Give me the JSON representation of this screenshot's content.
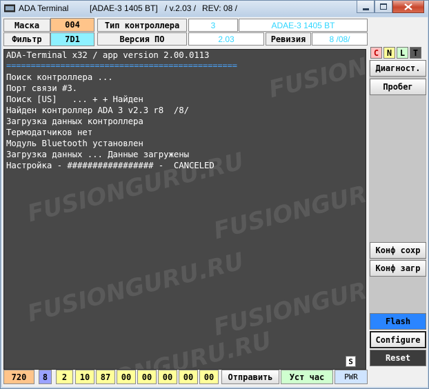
{
  "window": {
    "title": "ADA Terminal",
    "device": "[ADAE-3 1405 BT]",
    "version": "/ v.2.03 /",
    "rev": "REV: 08 /"
  },
  "header": {
    "mask_label": "Маска",
    "mask_value": "004",
    "filter_label": "Фильтр",
    "filter_value": "7D1",
    "controller_type_label": "Тип контроллера",
    "controller_type_num": "3",
    "controller_type_name": "ADAE-3 1405 BT",
    "sw_version_label": "Версия ПО",
    "sw_version_value": "2.03",
    "revision_label": "Ревизия",
    "revision_value": "8 /08/"
  },
  "terminal": {
    "lines": [
      "ADA-Terminal x32 / app version 2.00.0113",
      "===============================================",
      "Поиск контроллера ...",
      "Порт связи #3.",
      "Поиск [US]   ... + + Найден",
      "Найден контроллер ADA 3 v2.3 r8  /8/",
      "Загрузка данных контроллера",
      "Термодатчиков нет",
      "Модуль Bluetooth установлен",
      "Загрузка данных ... Данные загружены",
      "Настройка - ################# -  CANCELED"
    ],
    "watermark": "FUSIONGURU.RU"
  },
  "sidebar": {
    "c": "C",
    "n": "N",
    "l": "L",
    "t": "T",
    "diag": "Диагност.",
    "mileage": "Пробег",
    "conf_save": "Конф сохр",
    "conf_load": "Конф загр",
    "flash": "Flash",
    "configure": "Configure",
    "reset": "Reset"
  },
  "statusbar": {
    "s_button": "S",
    "speed": "720",
    "num": "8",
    "bytes": [
      "2",
      "10",
      "87",
      "00",
      "00",
      "00",
      "00",
      "00"
    ],
    "send": "Отправить",
    "set_clock": "Уст час",
    "pwr": "PWR"
  },
  "colors": {
    "orange": "#ffc48a",
    "cyan": "#8ef1ff",
    "yellow": "#ffff9a",
    "lightgreen": "#cfffcf",
    "flash_blue": "#2a85ff",
    "reset_dark": "#3c3c3c",
    "terminal_bg": "#484848"
  }
}
